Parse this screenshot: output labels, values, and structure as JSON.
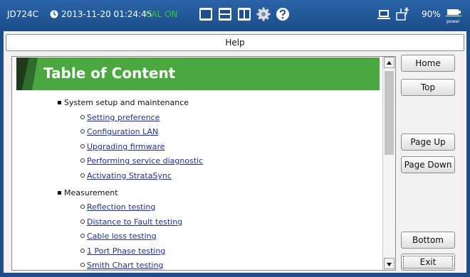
{
  "status": {
    "device": "JD724C",
    "datetime": "2013-11-20 01:24:45",
    "cal": "CAL ON",
    "battery": "90%",
    "power_label": "power",
    "icons": [
      "clock-icon",
      "single-view-icon",
      "split-horizontal-icon",
      "split-vertical-icon",
      "settings-gear-icon",
      "help-icon",
      "screen-icon",
      "usb-icon",
      "battery-icon"
    ]
  },
  "help": {
    "title": "Help",
    "heading": "Table of Content",
    "sections": [
      {
        "title": "System setup and maintenance",
        "links": [
          "Setting preference",
          "Configuration LAN",
          "Upgrading firmware",
          "Performing service diagnostic",
          "Activating StrataSync"
        ]
      },
      {
        "title": "Measurement",
        "links": [
          "Reflection testing",
          "Distance to Fault testing",
          "Cable loss testing",
          "1 Port Phase testing",
          "Smith Chart testing"
        ]
      }
    ]
  },
  "buttons": {
    "home": "Home",
    "top": "Top",
    "page_up": "Page Up",
    "page_down": "Page Down",
    "bottom": "Bottom",
    "exit": "Exit"
  },
  "colors": {
    "statusbar": "#1d4f8b",
    "cal_on": "#34c73a",
    "banner": "#4aa83f",
    "link": "#1d2fa0"
  }
}
